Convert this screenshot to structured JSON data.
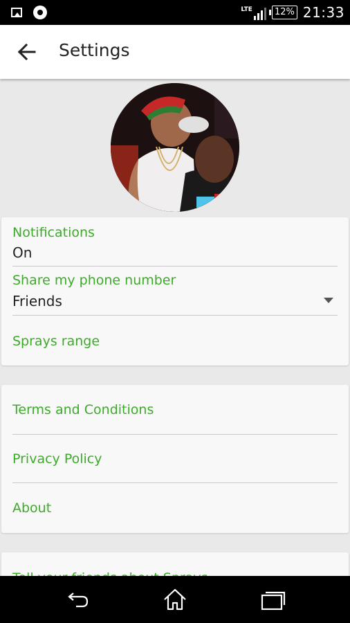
{
  "status_bar": {
    "network": "LTE",
    "battery": "12%",
    "time": "21:33",
    "icons": [
      "gallery-icon",
      "chrome-icon",
      "signal-icon",
      "battery-icon"
    ]
  },
  "app_bar": {
    "title": "Settings",
    "back_icon": "arrow-back-icon"
  },
  "profile": {
    "avatar": "profile-photo"
  },
  "preferences": {
    "notifications": {
      "label": "Notifications",
      "value": "On"
    },
    "share_phone": {
      "label": "Share my phone number",
      "value": "Friends"
    },
    "sprays_range": {
      "label": "Sprays range"
    }
  },
  "legal": {
    "items": [
      {
        "label": "Terms and Conditions"
      },
      {
        "label": "Privacy Policy"
      },
      {
        "label": "About"
      }
    ]
  },
  "more": {
    "partial_label": "Tell your friends about Sprays"
  },
  "nav_bar": {
    "icons": [
      "back-icon",
      "home-icon",
      "recents-icon"
    ]
  },
  "colors": {
    "accent": "#3daa2a",
    "background": "#e9e9e9",
    "card": "#f8f8f8",
    "bars": "#000000"
  }
}
